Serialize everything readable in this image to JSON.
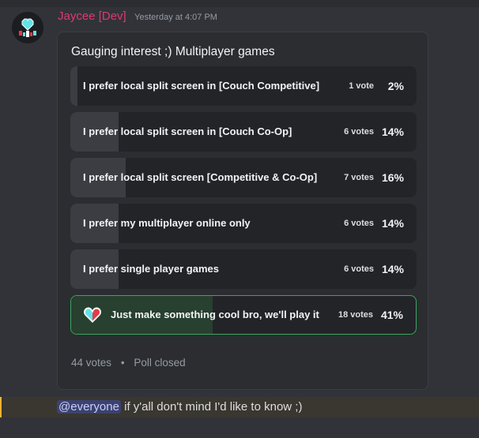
{
  "message": {
    "author": "Jaycee [Dev]",
    "timestamp": "Yesterday at 4:07 PM",
    "text_mention": "@everyone",
    "text_rest": " if y'all don't mind I'd like to know ;)"
  },
  "poll": {
    "question": "Gauging interest ;) Multiplayer games",
    "answers": [
      {
        "label": "I prefer local split screen in [Couch Competitive]",
        "votes": "1 vote",
        "percent": "2%",
        "share": 0.02
      },
      {
        "label": "I prefer local split screen in [Couch Co-Op]",
        "votes": "6 votes",
        "percent": "14%",
        "share": 0.14
      },
      {
        "label": "I prefer local split screen [Competitive & Co-Op]",
        "votes": "7 votes",
        "percent": "16%",
        "share": 0.16
      },
      {
        "label": "I prefer my multiplayer online only",
        "votes": "6 votes",
        "percent": "14%",
        "share": 0.14
      },
      {
        "label": "I prefer single player games",
        "votes": "6 votes",
        "percent": "14%",
        "share": 0.14
      },
      {
        "label": "Just make something cool bro, we'll play it",
        "votes": "18 votes",
        "percent": "41%",
        "share": 0.41,
        "winner": true,
        "icon": "heart-icon"
      }
    ],
    "total_votes": "44 votes",
    "separator": "•",
    "status": "Poll closed"
  },
  "colors": {
    "author": "#e0386f",
    "winner_border": "#3ba55c",
    "mention_bg": "#3c4270"
  }
}
